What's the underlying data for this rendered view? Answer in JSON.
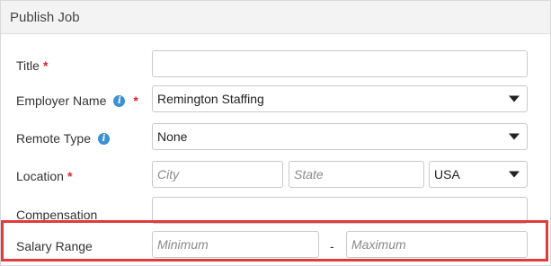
{
  "panel": {
    "title": "Publish Job"
  },
  "form": {
    "title": {
      "label": "Title",
      "required": "*",
      "value": ""
    },
    "employer": {
      "label": "Employer Name",
      "required": "*",
      "info": "i",
      "value": "Remington Staffing"
    },
    "remote": {
      "label": "Remote Type",
      "info": "i",
      "value": "None"
    },
    "location": {
      "label": "Location",
      "required": "*",
      "city_placeholder": "City",
      "state_placeholder": "State",
      "country_value": "USA"
    },
    "compensation": {
      "label": "Compensation",
      "value": ""
    },
    "salary": {
      "label": "Salary Range",
      "min_placeholder": "Minimum",
      "separator": "-",
      "max_placeholder": "Maximum"
    }
  },
  "colors": {
    "required": "#e0232e",
    "info_icon": "#3d8fd6",
    "highlight": "#e23b3b"
  }
}
